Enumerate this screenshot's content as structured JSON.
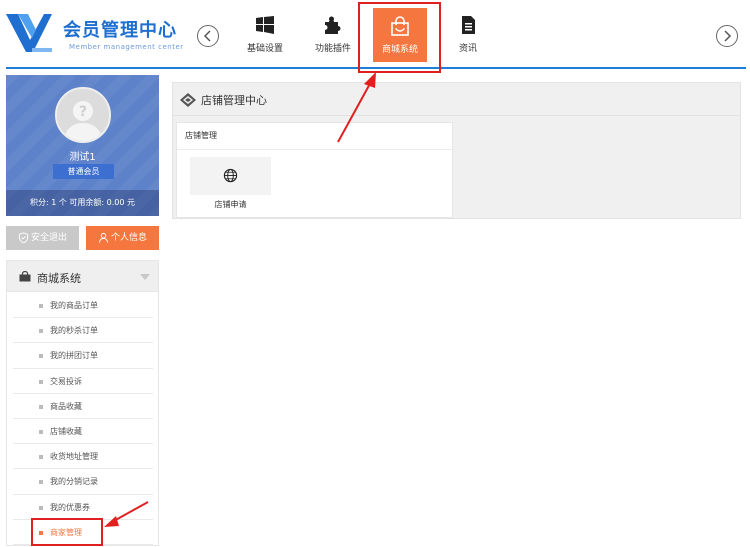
{
  "brand": {
    "title": "会员管理中心",
    "subtitle": "Member management center",
    "color": "#1e6fd0"
  },
  "nav": {
    "items": [
      {
        "label": "基础设置",
        "icon": "windows-grid-icon"
      },
      {
        "label": "功能插件",
        "icon": "puzzle-icon"
      },
      {
        "label": "商城系统",
        "icon": "shopping-bag-icon",
        "active": true
      },
      {
        "label": "资讯",
        "icon": "document-icon"
      }
    ],
    "prev_icon": "chevron-left-icon",
    "next_icon": "chevron-right-icon",
    "active_color": "#f5763f"
  },
  "user": {
    "name": "测试1",
    "level": "普通会员",
    "stats": "积分: 1  个  可用余额: 0.00  元"
  },
  "buttons": {
    "logout": "安全退出",
    "profile": "个人信息"
  },
  "menu": {
    "title": "商城系统",
    "items": [
      {
        "label": "我的商品订单"
      },
      {
        "label": "我的秒杀订单"
      },
      {
        "label": "我的拼团订单"
      },
      {
        "label": "交易投诉"
      },
      {
        "label": "商品收藏"
      },
      {
        "label": "店铺收藏"
      },
      {
        "label": "收货地址管理"
      },
      {
        "label": "我的分销记录"
      },
      {
        "label": "我的优惠券"
      },
      {
        "label": "商家管理",
        "active": true
      }
    ]
  },
  "main": {
    "title": "店铺管理中心",
    "section_title": "店铺管理",
    "tiles": [
      {
        "label": "店铺申请",
        "icon": "globe-icon"
      }
    ]
  },
  "colors": {
    "accent_blue": "#1f7ed8",
    "highlight_red": "#e02020",
    "orange": "#f5763f"
  }
}
